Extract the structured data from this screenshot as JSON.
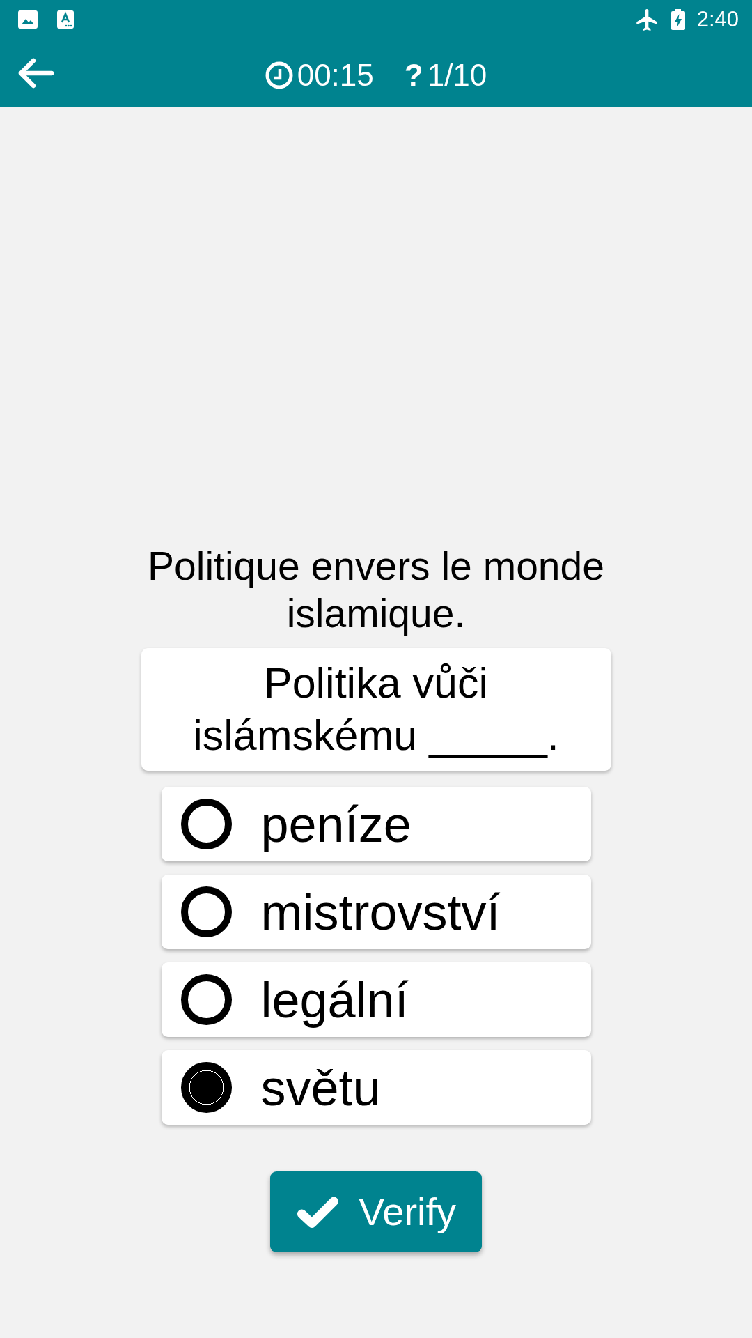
{
  "status_bar": {
    "time": "2:40"
  },
  "toolbar": {
    "timer": "00:15",
    "question_mark": "?",
    "progress": "1/10"
  },
  "prompt": "Politique envers le monde islamique.",
  "sentence": {
    "text": "Politika vůči islámskému",
    "blank": "_____",
    "end": "."
  },
  "options": [
    {
      "label": "peníze",
      "selected": false
    },
    {
      "label": "mistrovství",
      "selected": false
    },
    {
      "label": "legální",
      "selected": false
    },
    {
      "label": "světu",
      "selected": true
    }
  ],
  "verify_button": {
    "label": "Verify"
  }
}
